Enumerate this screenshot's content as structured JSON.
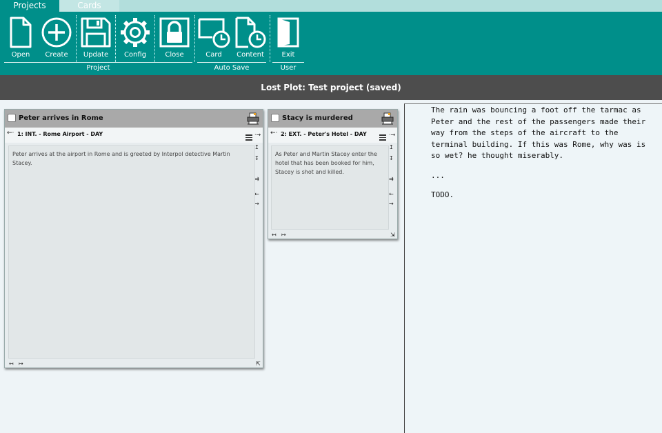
{
  "tabs": [
    {
      "label": "Projects",
      "active": true
    },
    {
      "label": "Cards",
      "active": false
    }
  ],
  "ribbon": {
    "buttons": [
      {
        "label": "Open",
        "icon": "document-icon"
      },
      {
        "label": "Create",
        "icon": "plus-circle-icon"
      },
      {
        "label": "Update",
        "icon": "floppy-disk-icon"
      },
      {
        "label": "Config",
        "icon": "gear-icon"
      },
      {
        "label": "Close",
        "icon": "lock-icon"
      },
      {
        "label": "Card",
        "icon": "card-clock-icon"
      },
      {
        "label": "Content",
        "icon": "document-clock-icon"
      },
      {
        "label": "Exit",
        "icon": "door-icon"
      }
    ],
    "groups": [
      {
        "label": "Project"
      },
      {
        "label": "Auto Save"
      },
      {
        "label": "User"
      }
    ]
  },
  "title_bar": "Lost Plot: Test project (saved)",
  "cards": [
    {
      "title": "Peter arrives in Rome",
      "arrow": "←·",
      "scene": "1: INT. - Rome Airport - DAY",
      "text": "Peter arrives at the airport in Rome and is greeted by Interpol detective Martin Stacey.",
      "side_controls": [
        "·→",
        "↥",
        "↧",
        "⇉",
        "←",
        "→"
      ],
      "foot_left": "↤",
      "foot_right": "↦",
      "resize": "⇱"
    },
    {
      "title": "Stacy is murdered",
      "arrow": "←·",
      "scene": "2: EXT. - Peter's Hotel - DAY",
      "text": "As Peter and Martin Stacey enter the hotel that has been booked for him, Stacey is shot and killed.",
      "side_controls": [
        "·→",
        "↥",
        "↧",
        "⇉",
        "←",
        "→"
      ],
      "foot_left": "↤",
      "foot_right": "↦",
      "resize": "⇲"
    }
  ],
  "content_pane": {
    "paragraphs": [
      "The rain was bouncing a foot off the tarmac as Peter and the rest of the passengers made their way from the steps of the aircraft to the terminal building. If this was Rome, why was is so wet? he thought miserably.",
      "...",
      "TODO."
    ]
  },
  "colors": {
    "teal": "#008f8a",
    "tab_strip": "#b2dedc",
    "title_bar": "#4d4d4d",
    "card_header": "#a9a9a9"
  }
}
